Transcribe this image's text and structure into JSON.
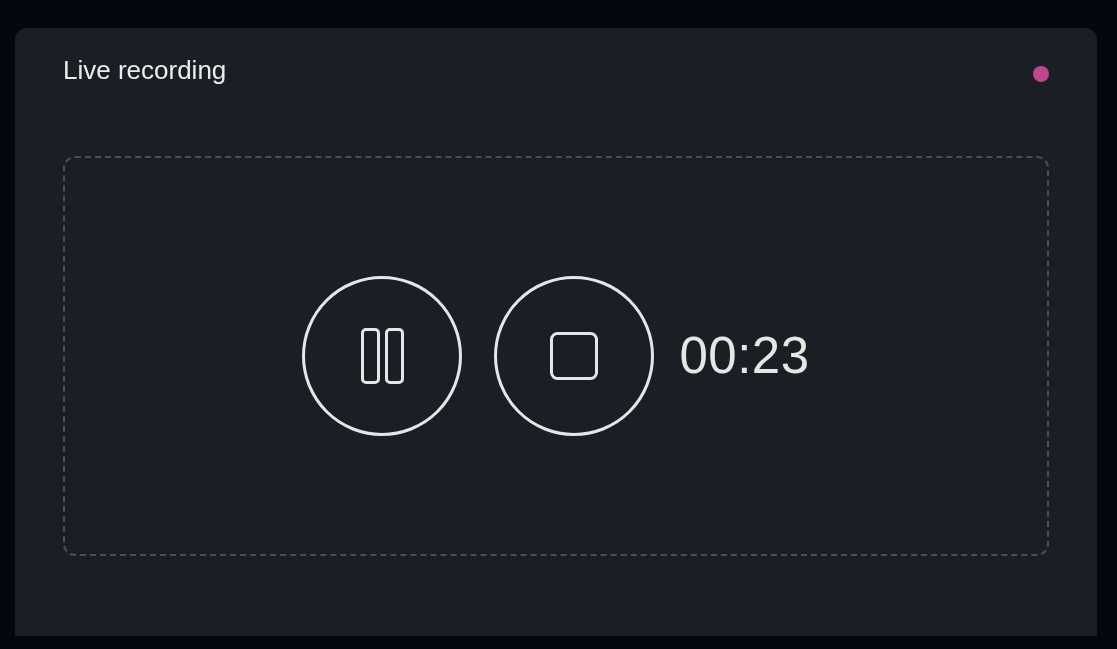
{
  "card": {
    "title": "Live recording",
    "recording_indicator": {
      "on": true
    }
  },
  "recorder": {
    "controls": [
      {
        "kind": "pause"
      },
      {
        "kind": "stop"
      }
    ],
    "elapsed": "00:23"
  }
}
